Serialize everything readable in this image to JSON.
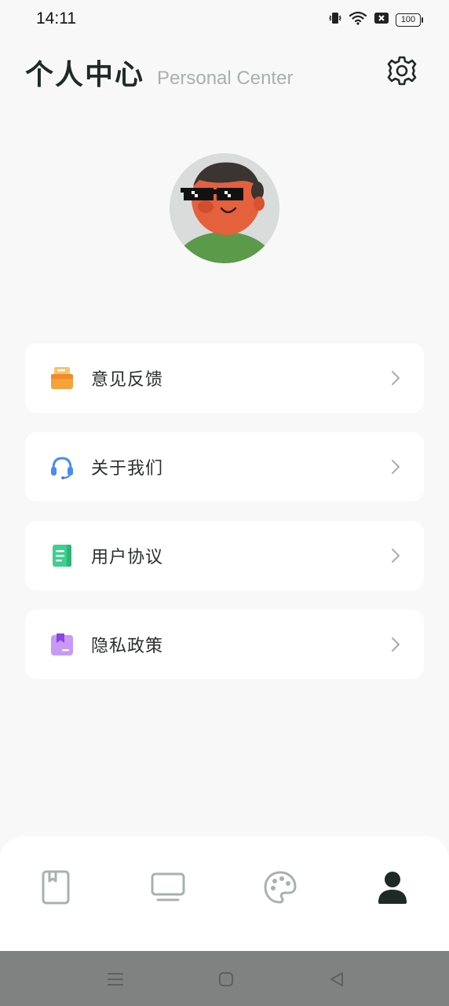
{
  "status_bar": {
    "time": "14:11",
    "battery": "100",
    "icons": [
      "vibrate-icon",
      "wifi-icon",
      "sim-off-icon",
      "battery-icon"
    ]
  },
  "header": {
    "title": "个人中心",
    "subtitle": "Personal Center",
    "settings_icon": "gear-icon"
  },
  "avatar": {
    "icon": "avatar-cartoon-sunglasses"
  },
  "menu": {
    "items": [
      {
        "label": "意见反馈",
        "icon": "feedback-inbox-icon",
        "color": "#f5a23b"
      },
      {
        "label": "关于我们",
        "icon": "headset-icon",
        "color": "#4a8cf0"
      },
      {
        "label": "用户协议",
        "icon": "agreement-doc-icon",
        "color": "#3fcf8e"
      },
      {
        "label": "隐私政策",
        "icon": "privacy-bookmark-icon",
        "color": "#a56bf0"
      }
    ]
  },
  "tabbar": {
    "tabs": [
      {
        "icon": "book-icon",
        "active": false
      },
      {
        "icon": "tv-icon",
        "active": false
      },
      {
        "icon": "palette-icon",
        "active": false
      },
      {
        "icon": "person-icon",
        "active": true
      }
    ],
    "colors": {
      "inactive": "#a9b1ae",
      "active": "#1f2a26"
    }
  },
  "navbar": {
    "buttons": [
      "menu-nav-icon",
      "home-nav-icon",
      "back-nav-icon"
    ]
  }
}
